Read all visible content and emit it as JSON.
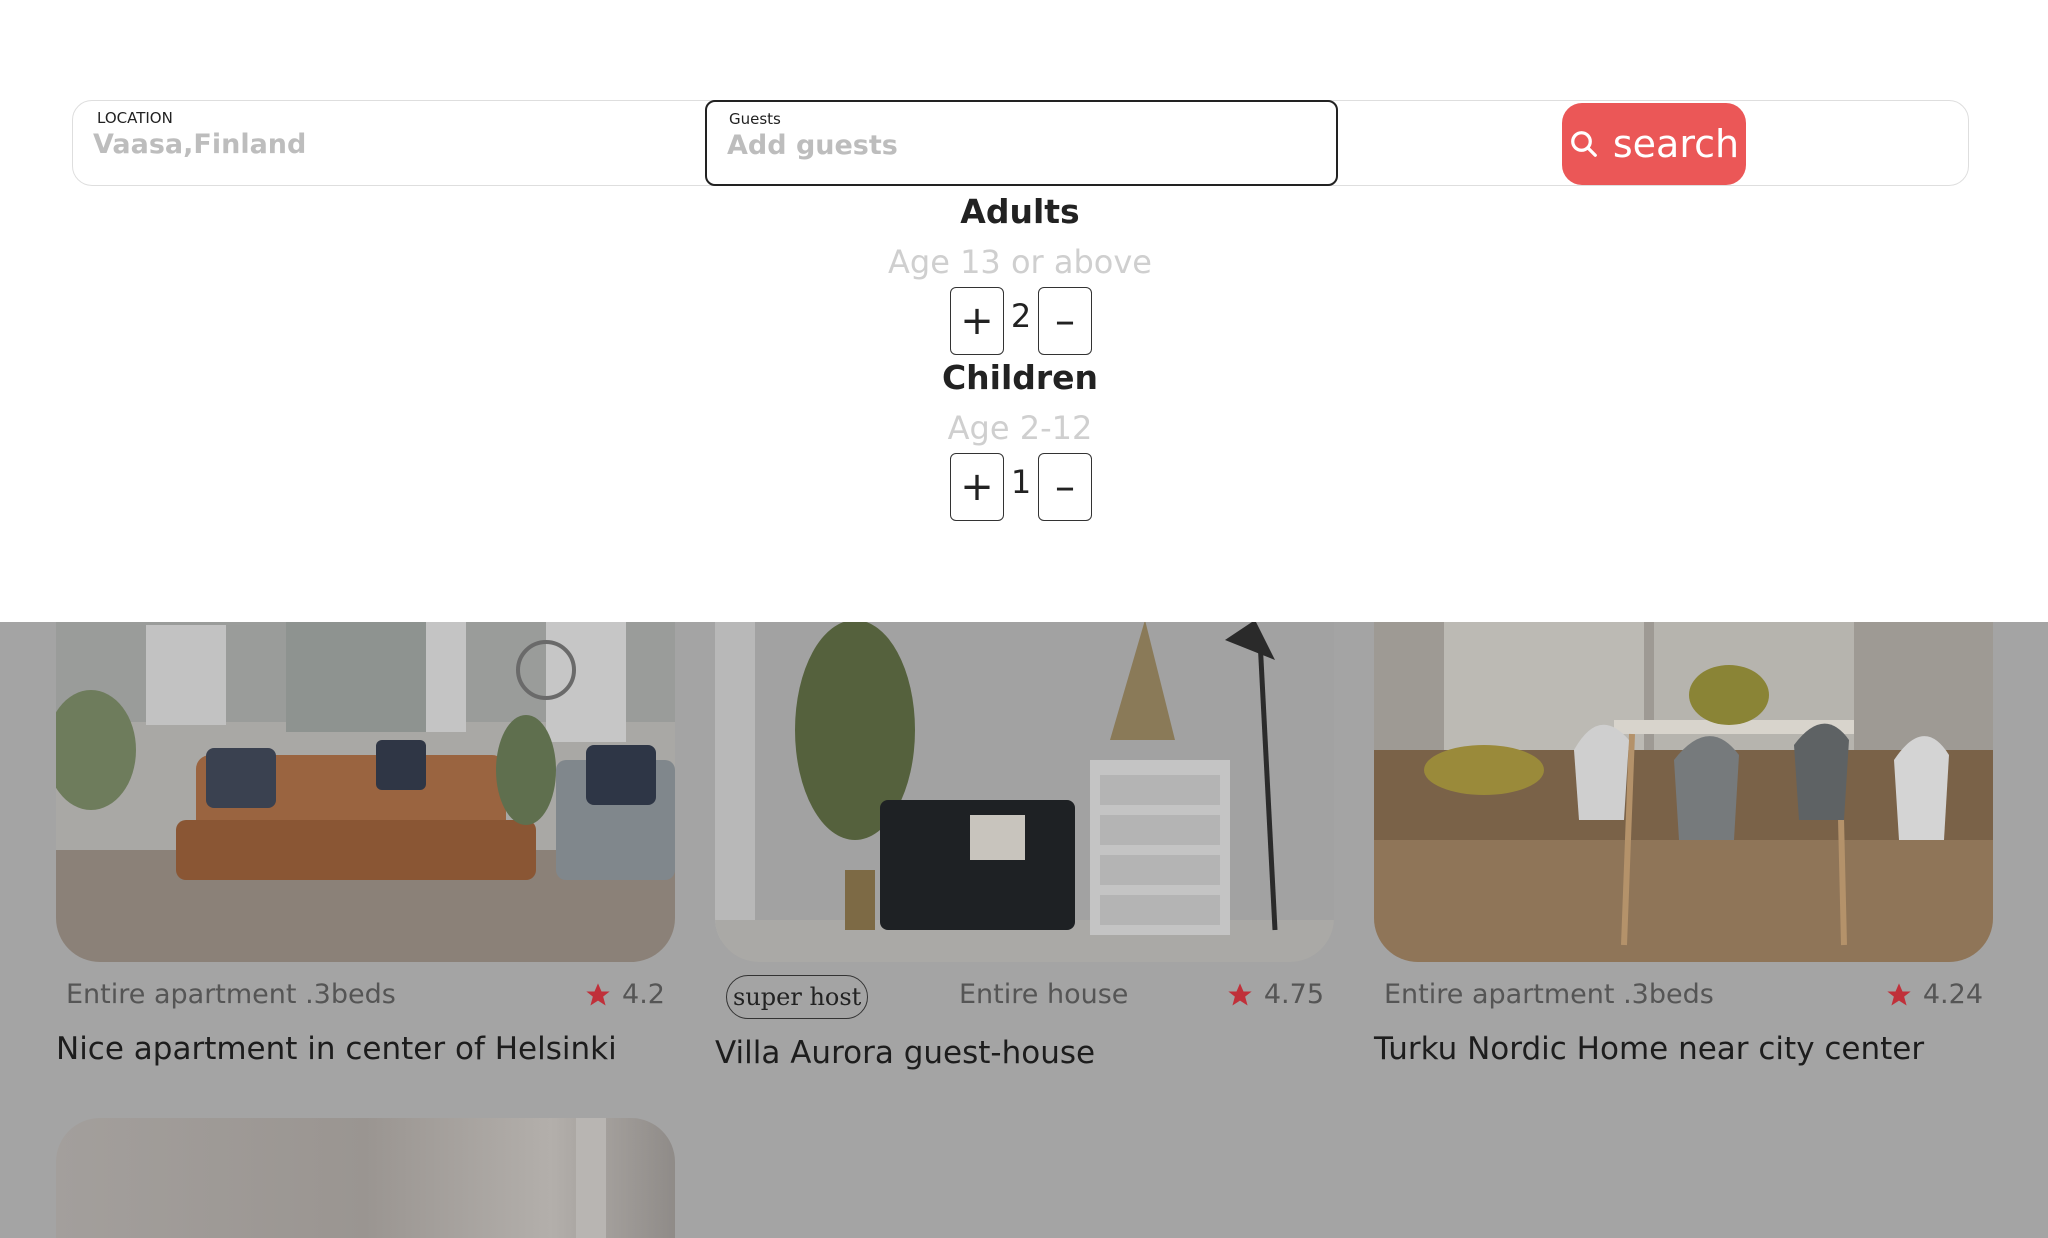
{
  "search": {
    "location_label": "LOCATION",
    "location_value": "Vaasa,Finland",
    "guests_label": "Guests",
    "guests_placeholder": "Add guests",
    "button_label": "search",
    "button_icon": "search-icon",
    "accent_color": "#eb5757"
  },
  "guests": {
    "adults": {
      "title": "Adults",
      "subtitle": "Age 13 or above",
      "count": "2",
      "plus": "+",
      "minus": "–"
    },
    "children": {
      "title": "Children",
      "subtitle": "Age 2-12",
      "count": "1",
      "plus": "+",
      "minus": "–"
    }
  },
  "listings": [
    {
      "type": "Entire apartment .3beds",
      "rating": "4.2",
      "title": "Nice apartment in center of Helsinki",
      "superhost": ""
    },
    {
      "type": "Entire house",
      "rating": "4.75",
      "title": "Villa Aurora guest-house",
      "superhost": "super host"
    },
    {
      "type": "Entire apartment .3beds",
      "rating": "4.24",
      "title": "Turku Nordic Home near city center",
      "superhost": ""
    }
  ],
  "star_color": "#c0303a"
}
